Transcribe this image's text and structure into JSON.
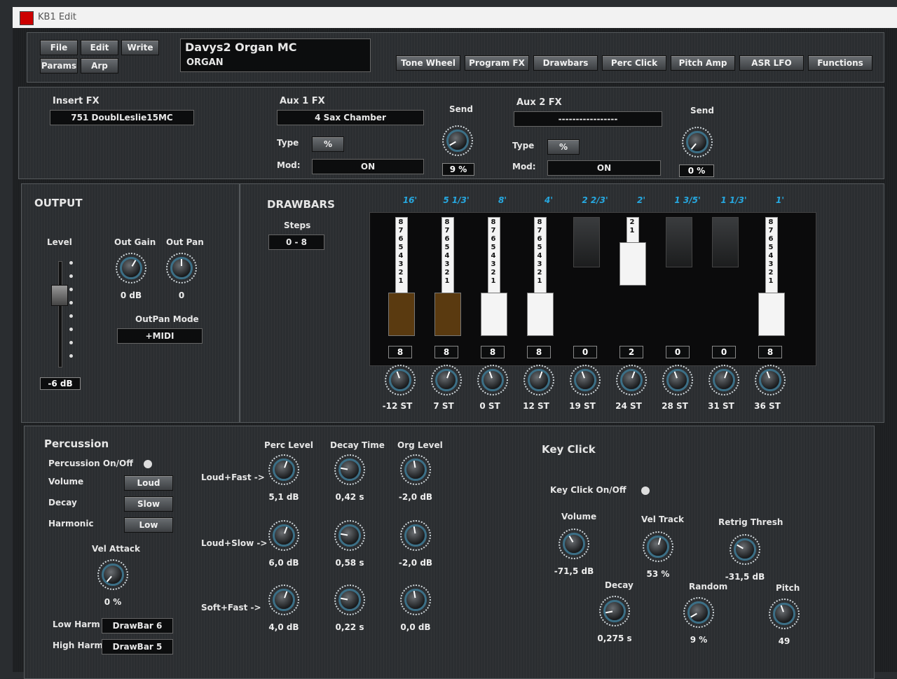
{
  "window_title": "KB1 Edit",
  "top_buttons": {
    "file": "File",
    "edit": "Edit",
    "write": "Write",
    "params": "Params",
    "arp": "Arp"
  },
  "program": {
    "name": "Davys2 Organ MC",
    "type": "ORGAN"
  },
  "tabs": [
    "Tone Wheel",
    "Program FX",
    "Drawbars",
    "Perc Click",
    "Pitch Amp",
    "ASR LFO",
    "Functions"
  ],
  "insert_fx": {
    "title": "Insert FX",
    "value": "751  DoublLeslie15MC"
  },
  "aux1": {
    "title": "Aux 1 FX",
    "value": "4  Sax Chamber",
    "type_label": "Type",
    "type_value": "%",
    "mod_label": "Mod:",
    "mod_value": "ON",
    "send_label": "Send",
    "send_value": "9 %"
  },
  "aux2": {
    "title": "Aux 2 FX",
    "value": "-----------------",
    "type_label": "Type",
    "type_value": "%",
    "mod_label": "Mod:",
    "mod_value": "ON",
    "send_label": "Send",
    "send_value": "0 %"
  },
  "output": {
    "title": "OUTPUT",
    "level_label": "Level",
    "level_value": "-6 dB",
    "level_fraction": 0.72,
    "gain_label": "Out Gain",
    "gain_value": "0 dB",
    "pan_label": "Out Pan",
    "pan_value": "0",
    "panmode_label": "OutPan Mode",
    "panmode_value": "+MIDI"
  },
  "drawbars": {
    "title": "DRAWBARS",
    "steps_label": "Steps",
    "steps_value": "0 - 8",
    "items": [
      {
        "footage": "16'",
        "value": "8",
        "level": 8,
        "color": "#5a3a10",
        "tune": "-12 ST"
      },
      {
        "footage": "5 1/3'",
        "value": "8",
        "level": 8,
        "color": "#5a3a10",
        "tune": "7 ST"
      },
      {
        "footage": "8'",
        "value": "8",
        "level": 8,
        "color": "#f4f4f4",
        "tune": "0 ST"
      },
      {
        "footage": "4'",
        "value": "8",
        "level": 8,
        "color": "#f4f4f4",
        "tune": "12 ST"
      },
      {
        "footage": "2 2/3'",
        "value": "0",
        "level": 0,
        "color": "#1c1d1e",
        "tune": "19 ST"
      },
      {
        "footage": "2'",
        "value": "2",
        "level": 2,
        "color": "#f4f4f4",
        "tune": "24 ST"
      },
      {
        "footage": "1 3/5'",
        "value": "0",
        "level": 0,
        "color": "#1c1d1e",
        "tune": "28 ST"
      },
      {
        "footage": "1 1/3'",
        "value": "0",
        "level": 0,
        "color": "#1c1d1e",
        "tune": "31 ST"
      },
      {
        "footage": "1'",
        "value": "8",
        "level": 8,
        "color": "#f4f4f4",
        "tune": "36 ST"
      }
    ]
  },
  "percussion": {
    "title": "Percussion",
    "onoff_label": "Percussion On/Off",
    "volume_label": "Volume",
    "volume_value": "Loud",
    "decay_label": "Decay",
    "decay_value": "Slow",
    "harmonic_label": "Harmonic",
    "harmonic_value": "Low",
    "velattack_label": "Vel Attack",
    "velattack_value": "0 %",
    "lowharm_label": "Low Harm",
    "lowharm_value": "DrawBar 6",
    "highharm_label": "High Harm",
    "highharm_value": "DrawBar 5",
    "col_perc": "Perc Level",
    "col_decay": "Decay Time",
    "col_org": "Org Level",
    "rows": [
      {
        "label": "Loud+Fast ->",
        "perc": "5,1 dB",
        "decay": "0,42 s",
        "org": "-2,0 dB"
      },
      {
        "label": "Loud+Slow ->",
        "perc": "6,0 dB",
        "decay": "0,58 s",
        "org": "-2,0 dB"
      },
      {
        "label": "Soft+Fast ->",
        "perc": "4,0 dB",
        "decay": "0,22 s",
        "org": "0,0 dB"
      }
    ]
  },
  "keyclick": {
    "title": "Key Click",
    "onoff_label": "Key Click  On/Off",
    "volume_label": "Volume",
    "volume_value": "-71,5 dB",
    "veltrack_label": "Vel Track",
    "veltrack_value": "53 %",
    "retrig_label": "Retrig Thresh",
    "retrig_value": "-31,5 dB",
    "decay_label": "Decay",
    "decay_value": "0,275 s",
    "random_label": "Random",
    "random_value": "9 %",
    "pitch_label": "Pitch",
    "pitch_value": "49"
  }
}
